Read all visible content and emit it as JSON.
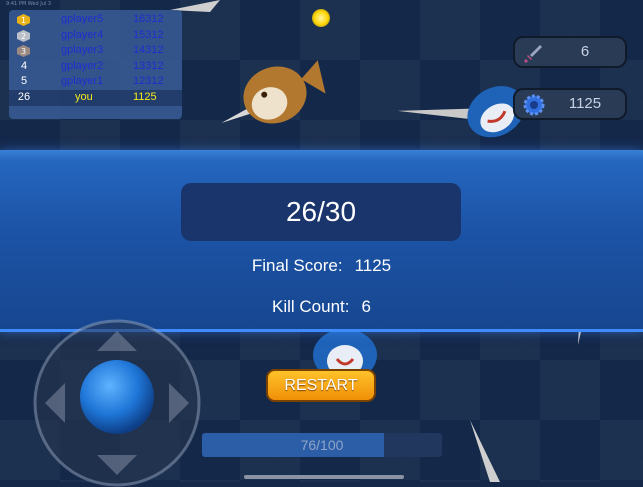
{
  "status_bar": {
    "text": "9:41 PM  Wed Jul 3"
  },
  "leaderboard": {
    "rows": [
      {
        "rank": "1",
        "medal": "gold-medal-icon",
        "name": "gplayer5",
        "score": "16312"
      },
      {
        "rank": "2",
        "medal": "silver-medal-icon",
        "name": "gplayer4",
        "score": "15312"
      },
      {
        "rank": "3",
        "medal": "bronze-medal-icon",
        "name": "gplayer3",
        "score": "14312"
      },
      {
        "rank": "4",
        "name": "gplayer2",
        "score": "13312"
      },
      {
        "rank": "5",
        "name": "gplayer1",
        "score": "12312"
      }
    ],
    "you": {
      "rank": "26",
      "name": "you",
      "score": "1125"
    }
  },
  "stats": {
    "kills": {
      "icon": "sword-icon",
      "value": "6"
    },
    "points": {
      "icon": "gear-coin-icon",
      "value": "1125"
    }
  },
  "result": {
    "round": "26/30",
    "final_score_label": "Final Score:",
    "final_score_value": "1125",
    "kill_count_label": "Kill Count:",
    "kill_count_value": "6"
  },
  "restart_label": "RESTART",
  "progress": {
    "label": "76/100",
    "fraction": 0.76
  },
  "colors": {
    "banner": "#1c53a6",
    "restart": "#f7a818",
    "leader_text": "#1f2ecf",
    "you_text": "#f3ea1a"
  }
}
